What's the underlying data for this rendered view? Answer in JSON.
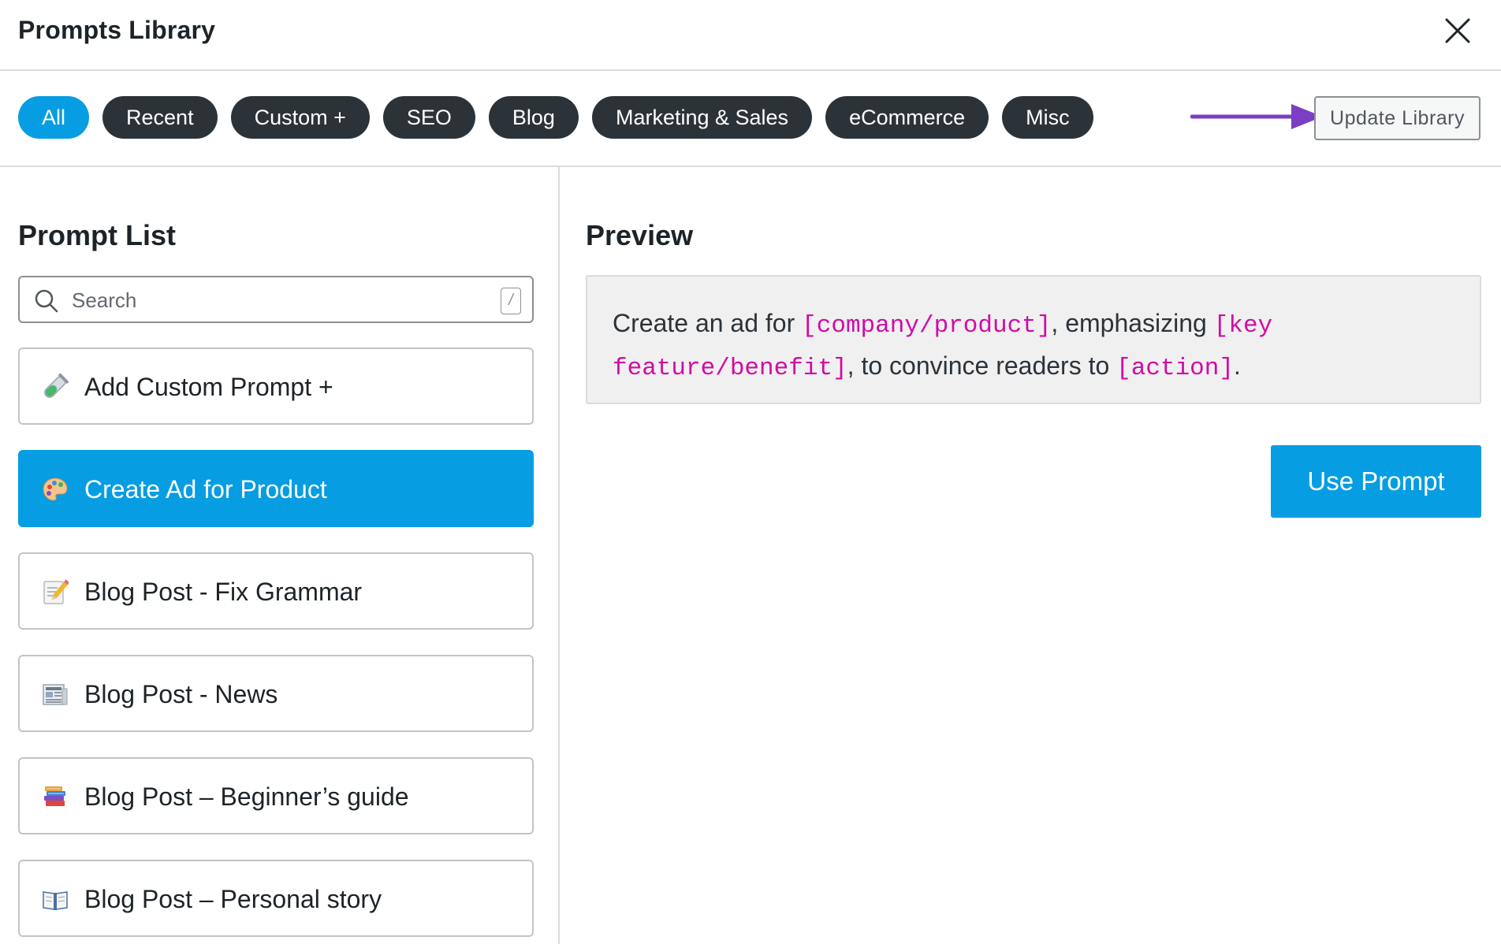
{
  "header": {
    "title": "Prompts Library",
    "close_icon": "close-icon"
  },
  "tabs": [
    {
      "label": "All",
      "active": true
    },
    {
      "label": "Recent",
      "active": false
    },
    {
      "label": "Custom +",
      "active": false
    },
    {
      "label": "SEO",
      "active": false
    },
    {
      "label": "Blog",
      "active": false
    },
    {
      "label": "Marketing & Sales",
      "active": false
    },
    {
      "label": "eCommerce",
      "active": false
    },
    {
      "label": "Misc",
      "active": false
    }
  ],
  "update_library_label": "Update Library",
  "left": {
    "title": "Prompt List",
    "search": {
      "placeholder": "Search",
      "shortcut": "/"
    },
    "prompts": [
      {
        "label": "Add Custom Prompt +",
        "icon": "test-tube-icon",
        "active": false
      },
      {
        "label": "Create Ad for Product",
        "icon": "palette-icon",
        "active": true
      },
      {
        "label": "Blog Post - Fix Grammar",
        "icon": "memo-icon",
        "active": false
      },
      {
        "label": "Blog Post - News",
        "icon": "newspaper-icon",
        "active": false
      },
      {
        "label": "Blog Post – Beginner’s guide",
        "icon": "books-icon",
        "active": false
      },
      {
        "label": "Blog Post – Personal story",
        "icon": "open-book-icon",
        "active": false
      }
    ]
  },
  "preview": {
    "title": "Preview",
    "text_1": "Create an ad for ",
    "code_1": "[company/product]",
    "text_2": ", emphasizing ",
    "code_2": "[key feature/benefit]",
    "text_3": ", to convince readers to ",
    "code_3": "[action]",
    "text_4": "."
  },
  "use_prompt_label": "Use Prompt",
  "colors": {
    "accent": "#069de3",
    "pill_dark": "#2c3338",
    "placeholder_code": "#d10ba4",
    "annotation_arrow": "#7b3fc4"
  }
}
